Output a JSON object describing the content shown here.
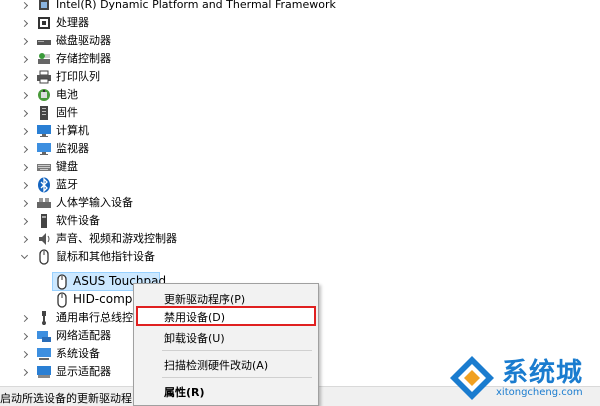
{
  "tree": {
    "categories": [
      {
        "label": "Intel(R) Dynamic Platform and Thermal Framework",
        "icon": "chip-icon"
      },
      {
        "label": "处理器",
        "icon": "processor-icon"
      },
      {
        "label": "磁盘驱动器",
        "icon": "disk-drive-icon"
      },
      {
        "label": "存储控制器",
        "icon": "storage-controller-icon"
      },
      {
        "label": "打印队列",
        "icon": "printer-icon"
      },
      {
        "label": "电池",
        "icon": "battery-icon"
      },
      {
        "label": "固件",
        "icon": "firmware-icon"
      },
      {
        "label": "计算机",
        "icon": "computer-icon"
      },
      {
        "label": "监视器",
        "icon": "monitor-icon"
      },
      {
        "label": "键盘",
        "icon": "keyboard-icon"
      },
      {
        "label": "蓝牙",
        "icon": "bluetooth-icon"
      },
      {
        "label": "人体学输入设备",
        "icon": "hid-icon"
      },
      {
        "label": "软件设备",
        "icon": "software-device-icon"
      },
      {
        "label": "声音、视频和游戏控制器",
        "icon": "speaker-icon"
      },
      {
        "label": "鼠标和其他指针设备",
        "icon": "mouse-icon"
      }
    ],
    "children": [
      {
        "label": "ASUS Touchpad",
        "icon": "mouse-icon"
      },
      {
        "label": "HID-compl",
        "icon": "mouse-icon"
      }
    ],
    "after": [
      {
        "label": "通用串行总线控",
        "icon": "usb-icon"
      },
      {
        "label": "网络适配器",
        "icon": "network-adapter-icon"
      },
      {
        "label": "系统设备",
        "icon": "system-device-icon"
      },
      {
        "label": "显示适配器",
        "icon": "display-adapter-icon"
      }
    ]
  },
  "context_menu": {
    "items": [
      "更新驱动程序(P)",
      "禁用设备(D)",
      "卸载设备(U)",
      "扫描检测硬件改动(A)",
      "属性(R)"
    ],
    "highlighted": "禁用设备(D)"
  },
  "status_bar": {
    "text": "启动所选设备的更新驱动程"
  },
  "watermark": {
    "brand": "系统城",
    "url": "xitongcheng.com"
  },
  "colors": {
    "selection": "#cce8ff",
    "highlight_border": "#e02020",
    "watermark": "#1a7ccf"
  }
}
